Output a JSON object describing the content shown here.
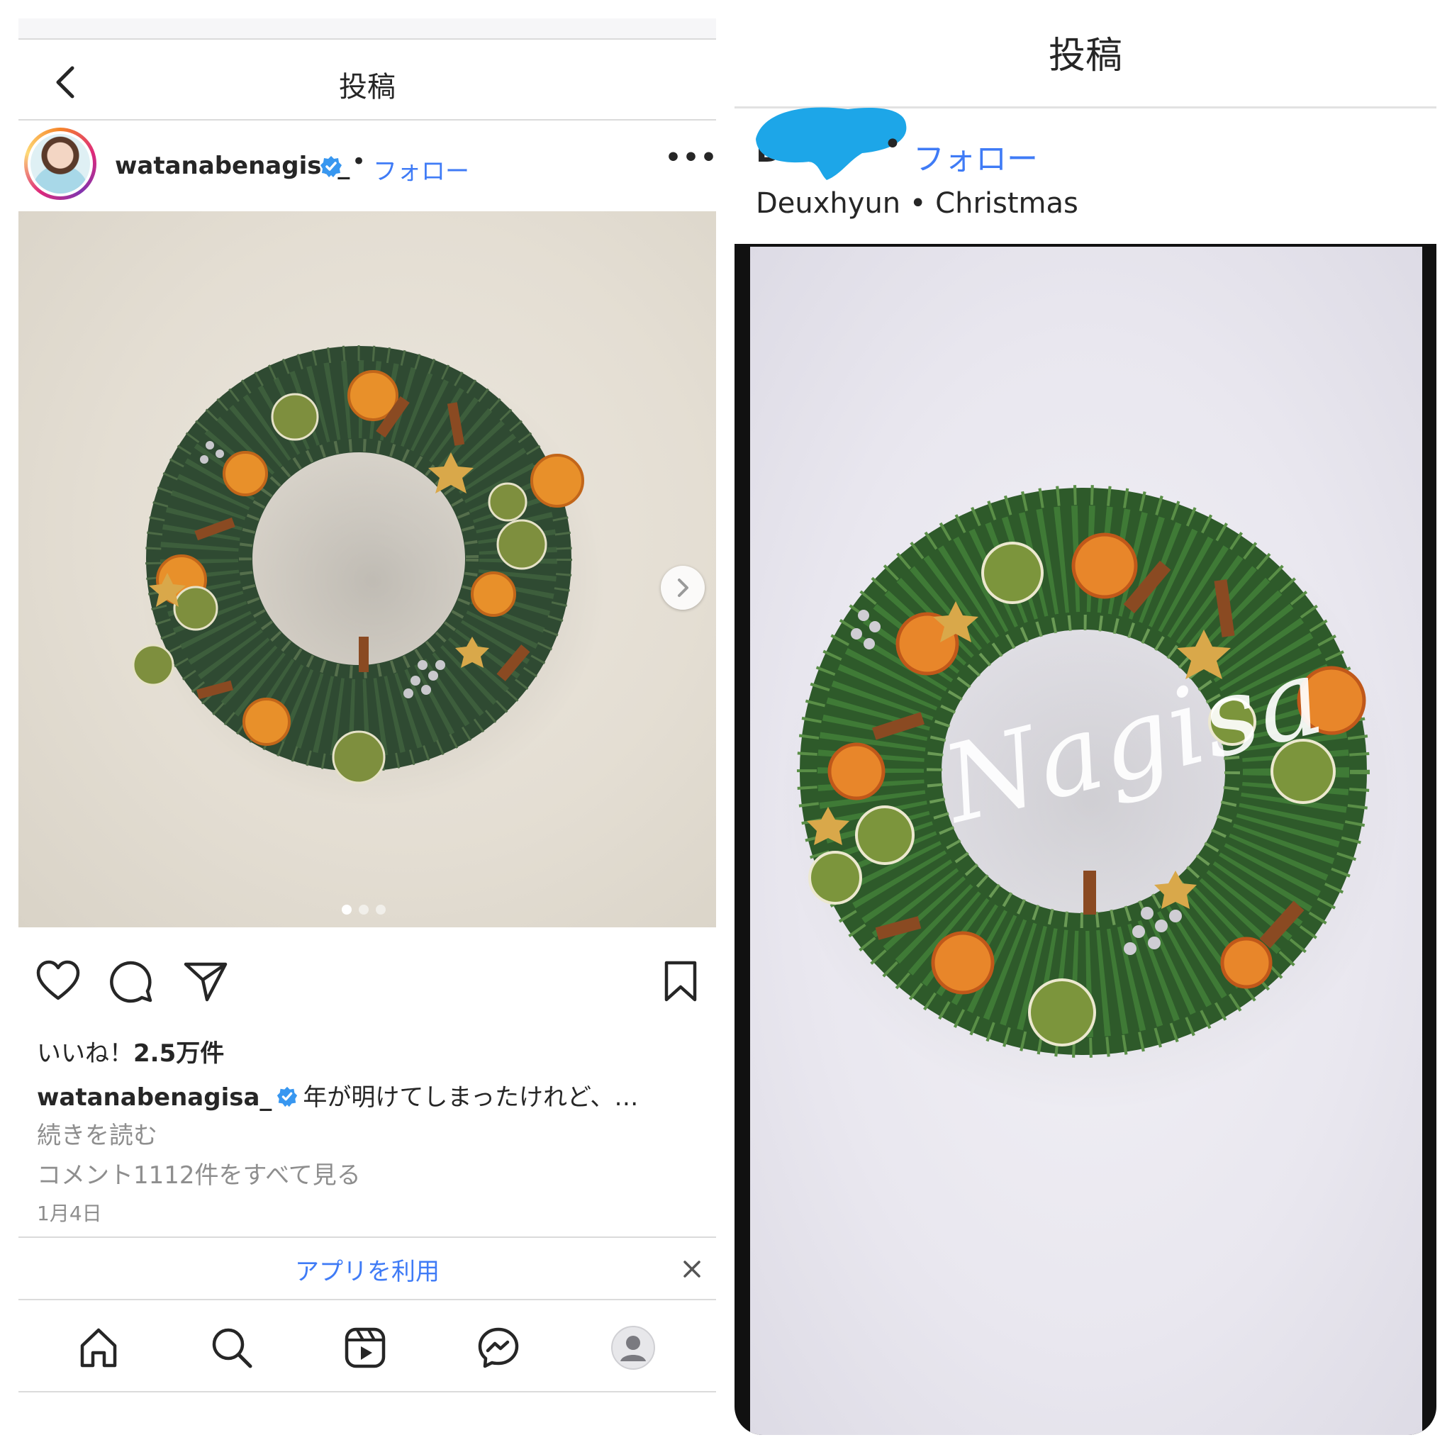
{
  "left_panel": {
    "header": {
      "title": "投稿"
    },
    "post": {
      "username": "watanabenagisa_",
      "separator": "•",
      "follow_label": "フォロー",
      "more_label": "•••",
      "likes_prefix": "いいね！",
      "likes_count": "2.5万件",
      "caption_user": "watanabenagisa_",
      "caption_text": "年が明けてしまったけれど、…",
      "read_more": "続きを読む",
      "comments_link": "コメント1112件をすべて見る",
      "date": "1月4日",
      "carousel_total": 3,
      "carousel_current": 1
    },
    "app_banner": {
      "label": "アプリを利用"
    },
    "colors": {
      "link_blue": "#3f7bf6",
      "verified_blue": "#3897f0",
      "text": "#262626",
      "muted": "#8e8e8e"
    },
    "icons": {
      "back": "chevron-left-icon",
      "like": "heart-icon",
      "comment": "comment-icon",
      "share": "paper-plane-icon",
      "save": "bookmark-icon",
      "close": "close-icon",
      "nav": [
        "home-icon",
        "search-icon",
        "reels-icon",
        "messenger-icon",
        "profile-icon"
      ]
    }
  },
  "right_panel": {
    "title": "投稿",
    "username_partial": "Deu",
    "separator": "•",
    "follow_label": "フォロー",
    "subtitle": "Deuxhyun • Christmas",
    "watermark": "Nagisa",
    "redaction_color": "#1da6e8"
  }
}
